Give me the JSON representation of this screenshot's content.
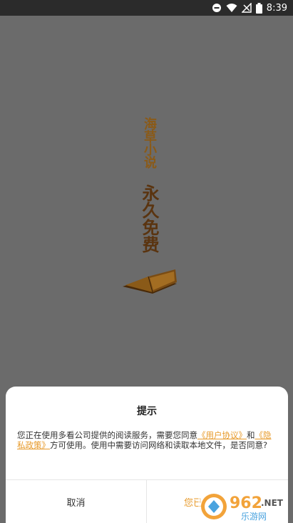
{
  "status_bar": {
    "time": "8:39",
    "icons": [
      "dnd-icon",
      "wifi-icon",
      "signal-icon",
      "battery-icon"
    ]
  },
  "splash": {
    "app_name": "海草小说",
    "slogan": "永久免费"
  },
  "dialog": {
    "title": "提示",
    "body_prefix": "您正在使用多看公司提供的阅读服务，需要您同意",
    "user_agreement_link": "《用户协议》",
    "body_and": "和",
    "privacy_policy_link": "《隐私政策》",
    "body_suffix": "方可使用。使用中需要访问网络和读取本地文件，是否同意?",
    "cancel_label": "取消",
    "agree_label": "您已"
  },
  "watermark": {
    "brand_number": "962",
    "brand_suffix": ".NET",
    "brand_cn": "乐游网"
  },
  "colors": {
    "accent": "#e79a2a",
    "overlay": "#6b6b6b",
    "status_bar": "#2b2b2b"
  }
}
